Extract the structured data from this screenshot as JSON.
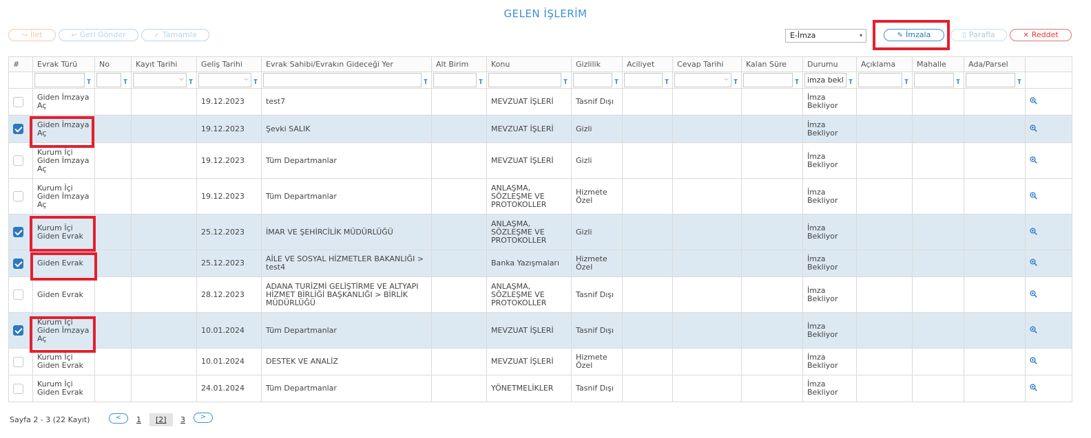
{
  "page_title": "GELEN İŞLERİM",
  "toolbar": {
    "ilet": "İlet",
    "geri_gonder": "Geri Gönder",
    "tamamla": "Tamamla",
    "imza_select": "E-İmza",
    "imzala": "İmzala",
    "parafla": "Parafla",
    "reddet": "Reddet"
  },
  "columns": [
    "#",
    "Evrak Türü",
    "No",
    "Kayıt Tarihi",
    "Geliş Tarihi",
    "Evrak Sahibi/Evrakın Gideceği Yer",
    "Alt Birim",
    "Konu",
    "Gizlilik",
    "Aciliyet",
    "Cevap Tarihi",
    "Kalan Süre",
    "Durumu",
    "Açıklama",
    "Mahalle",
    "Ada/Parsel"
  ],
  "filters": {
    "durumu_value": "imza bekl"
  },
  "rows": [
    {
      "checked": false,
      "evrak_turu": "Giden İmzaya Aç",
      "gelis_tarihi": "19.12.2023",
      "sahibi": "test7",
      "konu": "MEVZUAT İŞLERİ",
      "gizlilik": "Tasnif Dışı",
      "durumu": "İmza Bekliyor"
    },
    {
      "checked": true,
      "evrak_turu": "Giden İmzaya Aç",
      "gelis_tarihi": "19.12.2023",
      "sahibi": "Şevki SALIK",
      "konu": "MEVZUAT İŞLERİ",
      "gizlilik": "Gizli",
      "durumu": "İmza Bekliyor"
    },
    {
      "checked": false,
      "evrak_turu": "Kurum İçi Giden İmzaya Aç",
      "gelis_tarihi": "19.12.2023",
      "sahibi": "Tüm Departmanlar",
      "konu": "MEVZUAT İŞLERİ",
      "gizlilik": "Gizli",
      "durumu": "İmza Bekliyor"
    },
    {
      "checked": false,
      "evrak_turu": "Kurum İçi Giden İmzaya Aç",
      "gelis_tarihi": "19.12.2023",
      "sahibi": "Tüm Departmanlar",
      "konu": "ANLAŞMA, SÖZLEŞME VE PROTOKOLLER",
      "gizlilik": "Hizmete Özel",
      "durumu": "İmza Bekliyor"
    },
    {
      "checked": true,
      "evrak_turu": "Kurum İçi Giden Evrak",
      "gelis_tarihi": "25.12.2023",
      "sahibi": "İMAR VE ŞEHİRCİLİK MÜDÜRLÜĞÜ",
      "konu": "ANLAŞMA, SÖZLEŞME VE PROTOKOLLER",
      "gizlilik": "Gizli",
      "durumu": "İmza Bekliyor"
    },
    {
      "checked": true,
      "evrak_turu": "Giden Evrak",
      "gelis_tarihi": "25.12.2023",
      "sahibi": "AİLE VE SOSYAL HİZMETLER BAKANLIĞI > test4",
      "konu": "Banka Yazışmaları",
      "gizlilik": "Hizmete Özel",
      "durumu": "İmza Bekliyor"
    },
    {
      "checked": false,
      "evrak_turu": "Giden Evrak",
      "gelis_tarihi": "28.12.2023",
      "sahibi": "ADANA TURİZMİ GELİŞTİRME VE ALTYAPI HİZMET BİRLİĞİ BAŞKANLIĞI > BİRLİK MÜDÜRLÜĞÜ",
      "konu": "ANLAŞMA, SÖZLEŞME VE PROTOKOLLER",
      "gizlilik": "Tasnif Dışı",
      "durumu": "İmza Bekliyor"
    },
    {
      "checked": true,
      "evrak_turu": "Kurum İçi Giden İmzaya Aç",
      "gelis_tarihi": "10.01.2024",
      "sahibi": "Tüm Departmanlar",
      "konu": "MEVZUAT İŞLERİ",
      "gizlilik": "Tasnif Dışı",
      "durumu": "İmza Bekliyor"
    },
    {
      "checked": false,
      "evrak_turu": "Kurum İçi Giden Evrak",
      "gelis_tarihi": "10.01.2024",
      "sahibi": "DESTEK VE ANALİZ",
      "konu": "MEVZUAT İŞLERİ",
      "gizlilik": "Hizmete Özel",
      "durumu": "İmza Bekliyor"
    },
    {
      "checked": false,
      "evrak_turu": "Kurum İçi Giden Evrak",
      "gelis_tarihi": "24.01.2024",
      "sahibi": "Tüm Departmanlar",
      "konu": "YÖNETMELİKLER",
      "gizlilik": "Tasnif Dışı",
      "durumu": "İmza Bekliyor"
    }
  ],
  "pagination": {
    "summary": "Sayfa 2 - 3 (22 Kayıt)",
    "prev": "<",
    "next": ">",
    "pages": [
      "1",
      "[2]",
      "3"
    ]
  },
  "colors": {
    "accent": "#3b8fd6",
    "selected_row": "#dde9f2",
    "highlight": "#e3202e",
    "danger": "#e53935"
  }
}
